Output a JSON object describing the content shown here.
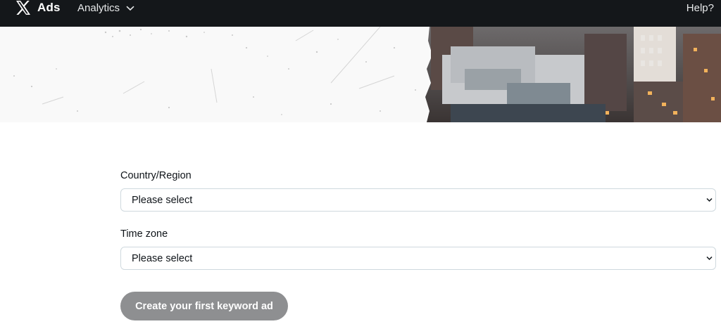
{
  "header": {
    "brand": "Ads",
    "nav_analytics": "Analytics",
    "help": "Help?"
  },
  "form": {
    "country": {
      "label": "Country/Region",
      "value": "Please select"
    },
    "timezone": {
      "label": "Time zone",
      "value": "Please select"
    },
    "submit_label": "Create your first keyword ad"
  },
  "colors": {
    "topbar": "#14171a",
    "button_disabled": "#8e8f91",
    "field_border": "#cfd9de"
  }
}
